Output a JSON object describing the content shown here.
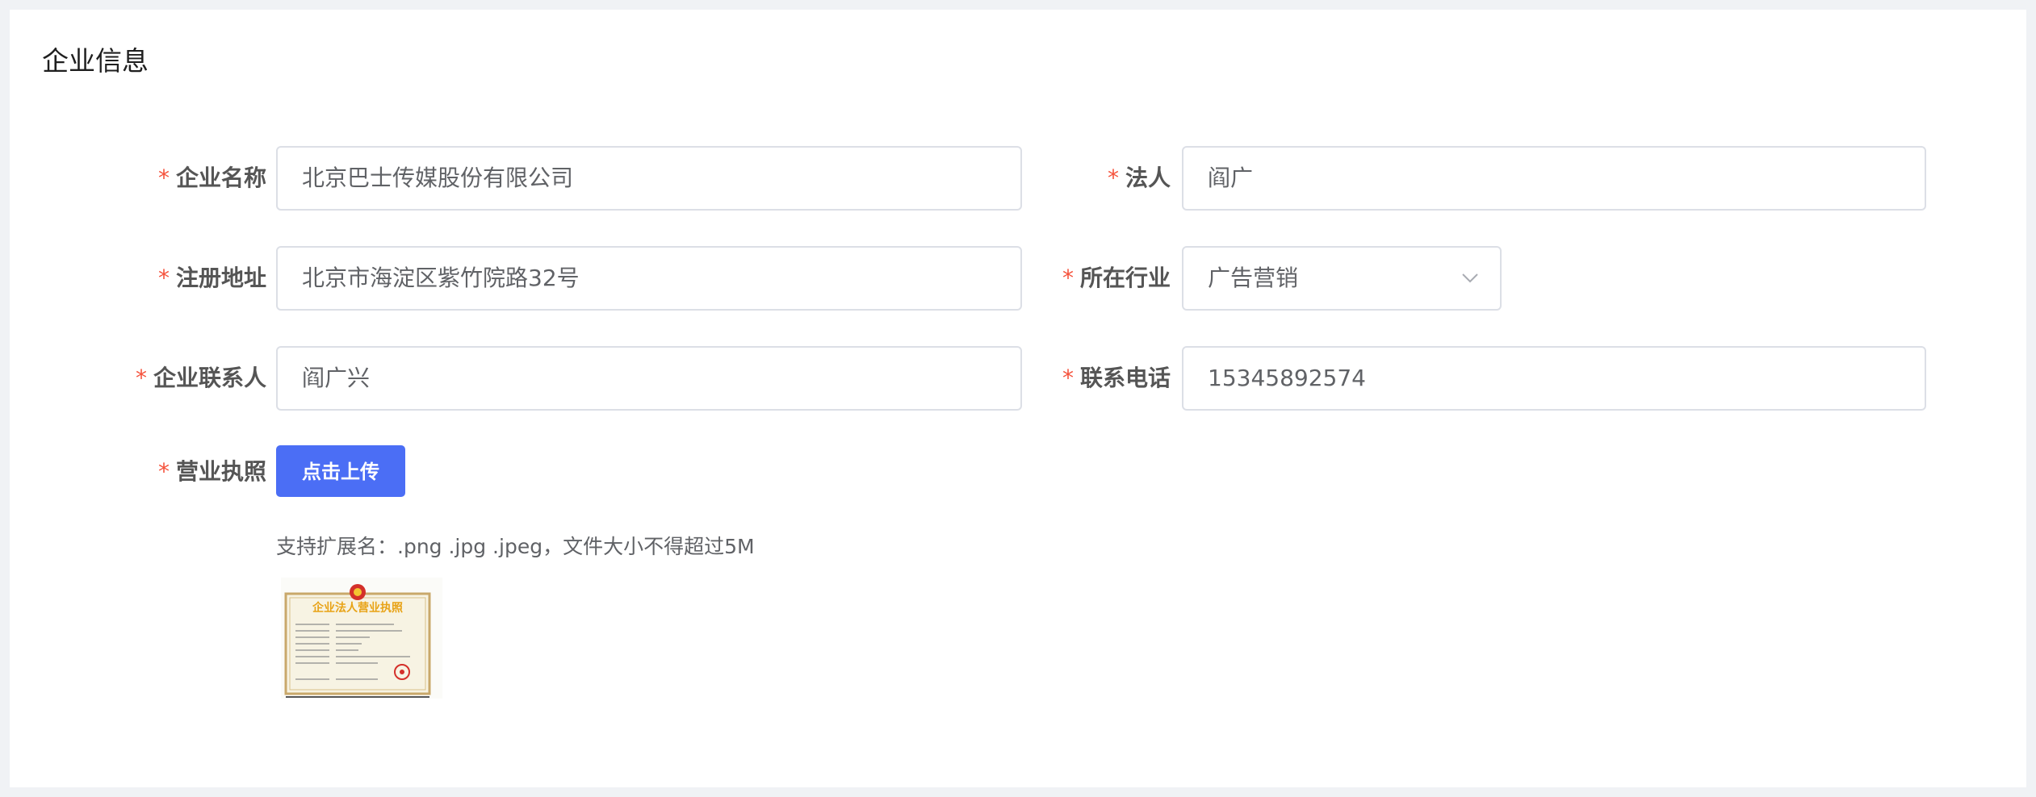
{
  "section": {
    "title": "企业信息"
  },
  "required_mark": "*",
  "fields": {
    "company_name": {
      "label": "企业名称",
      "value": "北京巴士传媒股份有限公司"
    },
    "legal_person": {
      "label": "法人",
      "value": "阎广"
    },
    "reg_address": {
      "label": "注册地址",
      "value": "北京市海淀区紫竹院路32号"
    },
    "industry": {
      "label": "所在行业",
      "value": "广告营销"
    },
    "contact": {
      "label": "企业联系人",
      "value": "阎广兴"
    },
    "phone": {
      "label": "联系电话",
      "value": "15345892574"
    },
    "license": {
      "label": "营业执照",
      "button": "点击上传",
      "hint": "支持扩展名：.png .jpg .jpeg，文件大小不得超过5M",
      "thumb_title": "企业法人营业执照"
    }
  },
  "colors": {
    "required": "#f5533d",
    "primary": "#4b6ef5",
    "border": "#dcdfe6",
    "certificate_gold": "#e8a317"
  },
  "icons": {
    "select_arrow": "chevron-down-icon",
    "thumbnail": "business-license-image"
  }
}
